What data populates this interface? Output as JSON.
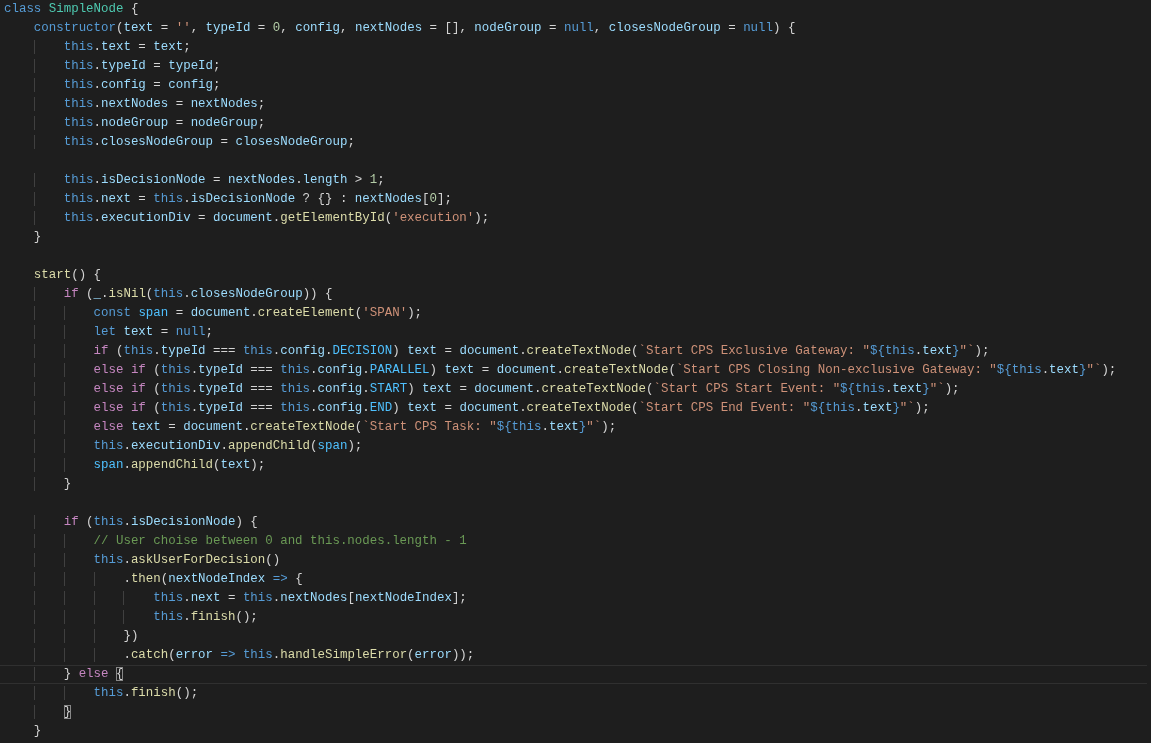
{
  "editor": {
    "lines": [
      {
        "current": false,
        "tokens": [
          {
            "kind": "key",
            "text": "class "
          },
          {
            "kind": "type",
            "text": "SimpleNode"
          },
          {
            "kind": "pun",
            "text": " {"
          }
        ]
      },
      {
        "current": false,
        "tokens": [
          {
            "kind": "key",
            "text": "    constructor"
          },
          {
            "kind": "pun",
            "text": "("
          },
          {
            "kind": "var",
            "text": "text"
          },
          {
            "kind": "pun",
            "text": " = "
          },
          {
            "kind": "str",
            "text": "''"
          },
          {
            "kind": "pun",
            "text": ", "
          },
          {
            "kind": "var",
            "text": "typeId"
          },
          {
            "kind": "pun",
            "text": " = "
          },
          {
            "kind": "num",
            "text": "0"
          },
          {
            "kind": "pun",
            "text": ", "
          },
          {
            "kind": "var",
            "text": "config"
          },
          {
            "kind": "pun",
            "text": ", "
          },
          {
            "kind": "var",
            "text": "nextNodes"
          },
          {
            "kind": "pun",
            "text": " = [], "
          },
          {
            "kind": "var",
            "text": "nodeGroup"
          },
          {
            "kind": "pun",
            "text": " = "
          },
          {
            "kind": "key",
            "text": "null"
          },
          {
            "kind": "pun",
            "text": ", "
          },
          {
            "kind": "var",
            "text": "closesNodeGroup"
          },
          {
            "kind": "pun",
            "text": " = "
          },
          {
            "kind": "key",
            "text": "null"
          },
          {
            "kind": "pun",
            "text": ") {"
          }
        ]
      },
      {
        "current": false,
        "tokens": [
          {
            "kind": "key",
            "text": "        this"
          },
          {
            "kind": "pun",
            "text": "."
          },
          {
            "kind": "var",
            "text": "text"
          },
          {
            "kind": "pun",
            "text": " = "
          },
          {
            "kind": "var",
            "text": "text"
          },
          {
            "kind": "pun",
            "text": ";"
          }
        ]
      },
      {
        "current": false,
        "tokens": [
          {
            "kind": "key",
            "text": "        this"
          },
          {
            "kind": "pun",
            "text": "."
          },
          {
            "kind": "var",
            "text": "typeId"
          },
          {
            "kind": "pun",
            "text": " = "
          },
          {
            "kind": "var",
            "text": "typeId"
          },
          {
            "kind": "pun",
            "text": ";"
          }
        ]
      },
      {
        "current": false,
        "tokens": [
          {
            "kind": "key",
            "text": "        this"
          },
          {
            "kind": "pun",
            "text": "."
          },
          {
            "kind": "var",
            "text": "config"
          },
          {
            "kind": "pun",
            "text": " = "
          },
          {
            "kind": "var",
            "text": "config"
          },
          {
            "kind": "pun",
            "text": ";"
          }
        ]
      },
      {
        "current": false,
        "tokens": [
          {
            "kind": "key",
            "text": "        this"
          },
          {
            "kind": "pun",
            "text": "."
          },
          {
            "kind": "var",
            "text": "nextNodes"
          },
          {
            "kind": "pun",
            "text": " = "
          },
          {
            "kind": "var",
            "text": "nextNodes"
          },
          {
            "kind": "pun",
            "text": ";"
          }
        ]
      },
      {
        "current": false,
        "tokens": [
          {
            "kind": "key",
            "text": "        this"
          },
          {
            "kind": "pun",
            "text": "."
          },
          {
            "kind": "var",
            "text": "nodeGroup"
          },
          {
            "kind": "pun",
            "text": " = "
          },
          {
            "kind": "var",
            "text": "nodeGroup"
          },
          {
            "kind": "pun",
            "text": ";"
          }
        ]
      },
      {
        "current": false,
        "tokens": [
          {
            "kind": "key",
            "text": "        this"
          },
          {
            "kind": "pun",
            "text": "."
          },
          {
            "kind": "var",
            "text": "closesNodeGroup"
          },
          {
            "kind": "pun",
            "text": " = "
          },
          {
            "kind": "var",
            "text": "closesNodeGroup"
          },
          {
            "kind": "pun",
            "text": ";"
          }
        ]
      },
      {
        "current": false
      },
      {
        "current": false,
        "tokens": [
          {
            "kind": "key",
            "text": "        this"
          },
          {
            "kind": "pun",
            "text": "."
          },
          {
            "kind": "var",
            "text": "isDecisionNode"
          },
          {
            "kind": "pun",
            "text": " = "
          },
          {
            "kind": "var",
            "text": "nextNodes"
          },
          {
            "kind": "pun",
            "text": "."
          },
          {
            "kind": "var",
            "text": "length"
          },
          {
            "kind": "pun",
            "text": " > "
          },
          {
            "kind": "num",
            "text": "1"
          },
          {
            "kind": "pun",
            "text": ";"
          }
        ]
      },
      {
        "current": false,
        "tokens": [
          {
            "kind": "key",
            "text": "        this"
          },
          {
            "kind": "pun",
            "text": "."
          },
          {
            "kind": "var",
            "text": "next"
          },
          {
            "kind": "pun",
            "text": " = "
          },
          {
            "kind": "key",
            "text": "this"
          },
          {
            "kind": "pun",
            "text": "."
          },
          {
            "kind": "var",
            "text": "isDecisionNode"
          },
          {
            "kind": "pun",
            "text": " ? {} : "
          },
          {
            "kind": "var",
            "text": "nextNodes"
          },
          {
            "kind": "pun",
            "text": "["
          },
          {
            "kind": "num",
            "text": "0"
          },
          {
            "kind": "pun",
            "text": "];"
          }
        ]
      },
      {
        "current": false,
        "tokens": [
          {
            "kind": "key",
            "text": "        this"
          },
          {
            "kind": "pun",
            "text": "."
          },
          {
            "kind": "var",
            "text": "executionDiv"
          },
          {
            "kind": "pun",
            "text": " = "
          },
          {
            "kind": "var",
            "text": "document"
          },
          {
            "kind": "pun",
            "text": "."
          },
          {
            "kind": "fn",
            "text": "getElementById"
          },
          {
            "kind": "pun",
            "text": "("
          },
          {
            "kind": "str",
            "text": "'execution'"
          },
          {
            "kind": "pun",
            "text": ");"
          }
        ]
      },
      {
        "current": false,
        "tokens": [
          {
            "kind": "pun",
            "text": "    }"
          }
        ]
      },
      {
        "current": false
      },
      {
        "current": false,
        "tokens": [
          {
            "kind": "fn",
            "text": "    start"
          },
          {
            "kind": "pun",
            "text": "() {"
          }
        ]
      },
      {
        "current": false,
        "tokens": [
          {
            "kind": "flow",
            "text": "        if"
          },
          {
            "kind": "pun",
            "text": " ("
          },
          {
            "kind": "var",
            "text": "_"
          },
          {
            "kind": "pun",
            "text": "."
          },
          {
            "kind": "fn",
            "text": "isNil"
          },
          {
            "kind": "pun",
            "text": "("
          },
          {
            "kind": "key",
            "text": "this"
          },
          {
            "kind": "pun",
            "text": "."
          },
          {
            "kind": "var",
            "text": "closesNodeGroup"
          },
          {
            "kind": "pun",
            "text": ")) {"
          }
        ]
      },
      {
        "current": false,
        "tokens": [
          {
            "kind": "key",
            "text": "            const "
          },
          {
            "kind": "const",
            "text": "span"
          },
          {
            "kind": "pun",
            "text": " = "
          },
          {
            "kind": "var",
            "text": "document"
          },
          {
            "kind": "pun",
            "text": "."
          },
          {
            "kind": "fn",
            "text": "createElement"
          },
          {
            "kind": "pun",
            "text": "("
          },
          {
            "kind": "str",
            "text": "'SPAN'"
          },
          {
            "kind": "pun",
            "text": ");"
          }
        ]
      },
      {
        "current": false,
        "tokens": [
          {
            "kind": "key",
            "text": "            let "
          },
          {
            "kind": "var",
            "text": "text"
          },
          {
            "kind": "pun",
            "text": " = "
          },
          {
            "kind": "key",
            "text": "null"
          },
          {
            "kind": "pun",
            "text": ";"
          }
        ]
      },
      {
        "current": false,
        "tokens": [
          {
            "kind": "flow",
            "text": "            if"
          },
          {
            "kind": "pun",
            "text": " ("
          },
          {
            "kind": "key",
            "text": "this"
          },
          {
            "kind": "pun",
            "text": "."
          },
          {
            "kind": "var",
            "text": "typeId"
          },
          {
            "kind": "pun",
            "text": " === "
          },
          {
            "kind": "key",
            "text": "this"
          },
          {
            "kind": "pun",
            "text": "."
          },
          {
            "kind": "var",
            "text": "config"
          },
          {
            "kind": "pun",
            "text": "."
          },
          {
            "kind": "const",
            "text": "DECISION"
          },
          {
            "kind": "pun",
            "text": ") "
          },
          {
            "kind": "var",
            "text": "text"
          },
          {
            "kind": "pun",
            "text": " = "
          },
          {
            "kind": "var",
            "text": "document"
          },
          {
            "kind": "pun",
            "text": "."
          },
          {
            "kind": "fn",
            "text": "createTextNode"
          },
          {
            "kind": "pun",
            "text": "("
          },
          {
            "kind": "str",
            "text": "`Start CPS Exclusive Gateway: \""
          },
          {
            "kind": "key",
            "text": "${this"
          },
          {
            "kind": "pun",
            "text": "."
          },
          {
            "kind": "var",
            "text": "text"
          },
          {
            "kind": "key",
            "text": "}"
          },
          {
            "kind": "str",
            "text": "\"`"
          },
          {
            "kind": "pun",
            "text": ");"
          }
        ]
      },
      {
        "current": false,
        "tokens": [
          {
            "kind": "flow",
            "text": "            else if"
          },
          {
            "kind": "pun",
            "text": " ("
          },
          {
            "kind": "key",
            "text": "this"
          },
          {
            "kind": "pun",
            "text": "."
          },
          {
            "kind": "var",
            "text": "typeId"
          },
          {
            "kind": "pun",
            "text": " === "
          },
          {
            "kind": "key",
            "text": "this"
          },
          {
            "kind": "pun",
            "text": "."
          },
          {
            "kind": "var",
            "text": "config"
          },
          {
            "kind": "pun",
            "text": "."
          },
          {
            "kind": "const",
            "text": "PARALLEL"
          },
          {
            "kind": "pun",
            "text": ") "
          },
          {
            "kind": "var",
            "text": "text"
          },
          {
            "kind": "pun",
            "text": " = "
          },
          {
            "kind": "var",
            "text": "document"
          },
          {
            "kind": "pun",
            "text": "."
          },
          {
            "kind": "fn",
            "text": "createTextNode"
          },
          {
            "kind": "pun",
            "text": "("
          },
          {
            "kind": "str",
            "text": "`Start CPS Closing Non-exclusive Gateway: \""
          },
          {
            "kind": "key",
            "text": "${this"
          },
          {
            "kind": "pun",
            "text": "."
          },
          {
            "kind": "var",
            "text": "text"
          },
          {
            "kind": "key",
            "text": "}"
          },
          {
            "kind": "str",
            "text": "\"`"
          },
          {
            "kind": "pun",
            "text": ");"
          }
        ]
      },
      {
        "current": false,
        "tokens": [
          {
            "kind": "flow",
            "text": "            else if"
          },
          {
            "kind": "pun",
            "text": " ("
          },
          {
            "kind": "key",
            "text": "this"
          },
          {
            "kind": "pun",
            "text": "."
          },
          {
            "kind": "var",
            "text": "typeId"
          },
          {
            "kind": "pun",
            "text": " === "
          },
          {
            "kind": "key",
            "text": "this"
          },
          {
            "kind": "pun",
            "text": "."
          },
          {
            "kind": "var",
            "text": "config"
          },
          {
            "kind": "pun",
            "text": "."
          },
          {
            "kind": "const",
            "text": "START"
          },
          {
            "kind": "pun",
            "text": ") "
          },
          {
            "kind": "var",
            "text": "text"
          },
          {
            "kind": "pun",
            "text": " = "
          },
          {
            "kind": "var",
            "text": "document"
          },
          {
            "kind": "pun",
            "text": "."
          },
          {
            "kind": "fn",
            "text": "createTextNode"
          },
          {
            "kind": "pun",
            "text": "("
          },
          {
            "kind": "str",
            "text": "`Start CPS Start Event: \""
          },
          {
            "kind": "key",
            "text": "${this"
          },
          {
            "kind": "pun",
            "text": "."
          },
          {
            "kind": "var",
            "text": "text"
          },
          {
            "kind": "key",
            "text": "}"
          },
          {
            "kind": "str",
            "text": "\"`"
          },
          {
            "kind": "pun",
            "text": ");"
          }
        ]
      },
      {
        "current": false,
        "tokens": [
          {
            "kind": "flow",
            "text": "            else if"
          },
          {
            "kind": "pun",
            "text": " ("
          },
          {
            "kind": "key",
            "text": "this"
          },
          {
            "kind": "pun",
            "text": "."
          },
          {
            "kind": "var",
            "text": "typeId"
          },
          {
            "kind": "pun",
            "text": " === "
          },
          {
            "kind": "key",
            "text": "this"
          },
          {
            "kind": "pun",
            "text": "."
          },
          {
            "kind": "var",
            "text": "config"
          },
          {
            "kind": "pun",
            "text": "."
          },
          {
            "kind": "const",
            "text": "END"
          },
          {
            "kind": "pun",
            "text": ") "
          },
          {
            "kind": "var",
            "text": "text"
          },
          {
            "kind": "pun",
            "text": " = "
          },
          {
            "kind": "var",
            "text": "document"
          },
          {
            "kind": "pun",
            "text": "."
          },
          {
            "kind": "fn",
            "text": "createTextNode"
          },
          {
            "kind": "pun",
            "text": "("
          },
          {
            "kind": "str",
            "text": "`Start CPS End Event: \""
          },
          {
            "kind": "key",
            "text": "${this"
          },
          {
            "kind": "pun",
            "text": "."
          },
          {
            "kind": "var",
            "text": "text"
          },
          {
            "kind": "key",
            "text": "}"
          },
          {
            "kind": "str",
            "text": "\"`"
          },
          {
            "kind": "pun",
            "text": ");"
          }
        ]
      },
      {
        "current": false,
        "tokens": [
          {
            "kind": "flow",
            "text": "            else "
          },
          {
            "kind": "var",
            "text": "text"
          },
          {
            "kind": "pun",
            "text": " = "
          },
          {
            "kind": "var",
            "text": "document"
          },
          {
            "kind": "pun",
            "text": "."
          },
          {
            "kind": "fn",
            "text": "createTextNode"
          },
          {
            "kind": "pun",
            "text": "("
          },
          {
            "kind": "str",
            "text": "`Start CPS Task: \""
          },
          {
            "kind": "key",
            "text": "${this"
          },
          {
            "kind": "pun",
            "text": "."
          },
          {
            "kind": "var",
            "text": "text"
          },
          {
            "kind": "key",
            "text": "}"
          },
          {
            "kind": "str",
            "text": "\"`"
          },
          {
            "kind": "pun",
            "text": ");"
          }
        ]
      },
      {
        "current": false,
        "tokens": [
          {
            "kind": "key",
            "text": "            this"
          },
          {
            "kind": "pun",
            "text": "."
          },
          {
            "kind": "var",
            "text": "executionDiv"
          },
          {
            "kind": "pun",
            "text": "."
          },
          {
            "kind": "fn",
            "text": "appendChild"
          },
          {
            "kind": "pun",
            "text": "("
          },
          {
            "kind": "const",
            "text": "span"
          },
          {
            "kind": "pun",
            "text": ");"
          }
        ]
      },
      {
        "current": false,
        "tokens": [
          {
            "kind": "const",
            "text": "            span"
          },
          {
            "kind": "pun",
            "text": "."
          },
          {
            "kind": "fn",
            "text": "appendChild"
          },
          {
            "kind": "pun",
            "text": "("
          },
          {
            "kind": "var",
            "text": "text"
          },
          {
            "kind": "pun",
            "text": ");"
          }
        ]
      },
      {
        "current": false,
        "tokens": [
          {
            "kind": "pun",
            "text": "        }"
          }
        ]
      },
      {
        "current": false
      },
      {
        "current": false,
        "tokens": [
          {
            "kind": "flow",
            "text": "        if"
          },
          {
            "kind": "pun",
            "text": " ("
          },
          {
            "kind": "key",
            "text": "this"
          },
          {
            "kind": "pun",
            "text": "."
          },
          {
            "kind": "var",
            "text": "isDecisionNode"
          },
          {
            "kind": "pun",
            "text": ") {"
          }
        ]
      },
      {
        "current": false,
        "tokens": [
          {
            "kind": "com",
            "text": "            // User choise between 0 and this.nodes.length - 1"
          }
        ]
      },
      {
        "current": false,
        "tokens": [
          {
            "kind": "key",
            "text": "            this"
          },
          {
            "kind": "pun",
            "text": "."
          },
          {
            "kind": "fn",
            "text": "askUserForDecision"
          },
          {
            "kind": "pun",
            "text": "()"
          }
        ]
      },
      {
        "current": false,
        "tokens": [
          {
            "kind": "pun",
            "text": "                ."
          },
          {
            "kind": "fn",
            "text": "then"
          },
          {
            "kind": "pun",
            "text": "("
          },
          {
            "kind": "var",
            "text": "nextNodeIndex"
          },
          {
            "kind": "key",
            "text": " => "
          },
          {
            "kind": "pun",
            "text": "{"
          }
        ]
      },
      {
        "current": false,
        "tokens": [
          {
            "kind": "key",
            "text": "                    this"
          },
          {
            "kind": "pun",
            "text": "."
          },
          {
            "kind": "var",
            "text": "next"
          },
          {
            "kind": "pun",
            "text": " = "
          },
          {
            "kind": "key",
            "text": "this"
          },
          {
            "kind": "pun",
            "text": "."
          },
          {
            "kind": "var",
            "text": "nextNodes"
          },
          {
            "kind": "pun",
            "text": "["
          },
          {
            "kind": "var",
            "text": "nextNodeIndex"
          },
          {
            "kind": "pun",
            "text": "];"
          }
        ]
      },
      {
        "current": false,
        "tokens": [
          {
            "kind": "key",
            "text": "                    this"
          },
          {
            "kind": "pun",
            "text": "."
          },
          {
            "kind": "fn",
            "text": "finish"
          },
          {
            "kind": "pun",
            "text": "();"
          }
        ]
      },
      {
        "current": false,
        "tokens": [
          {
            "kind": "pun",
            "text": "                })"
          }
        ]
      },
      {
        "current": false,
        "tokens": [
          {
            "kind": "pun",
            "text": "                ."
          },
          {
            "kind": "fn",
            "text": "catch"
          },
          {
            "kind": "pun",
            "text": "("
          },
          {
            "kind": "var",
            "text": "error"
          },
          {
            "kind": "key",
            "text": " => this"
          },
          {
            "kind": "pun",
            "text": "."
          },
          {
            "kind": "fn",
            "text": "handleSimpleError"
          },
          {
            "kind": "pun",
            "text": "("
          },
          {
            "kind": "var",
            "text": "error"
          },
          {
            "kind": "pun",
            "text": "));"
          }
        ]
      },
      {
        "current": true,
        "tokens": [
          {
            "kind": "pun",
            "text": "        } "
          },
          {
            "kind": "flow",
            "text": "else "
          },
          {
            "kind": "match",
            "text": "{"
          }
        ]
      },
      {
        "current": false,
        "tokens": [
          {
            "kind": "key",
            "text": "            this"
          },
          {
            "kind": "pun",
            "text": "."
          },
          {
            "kind": "fn",
            "text": "finish"
          },
          {
            "kind": "pun",
            "text": "();"
          }
        ]
      },
      {
        "current": false,
        "tokens": [
          {
            "kind": "match",
            "text": "        }"
          }
        ]
      },
      {
        "current": false,
        "tokens": [
          {
            "kind": "pun",
            "text": "    }"
          }
        ]
      }
    ]
  }
}
